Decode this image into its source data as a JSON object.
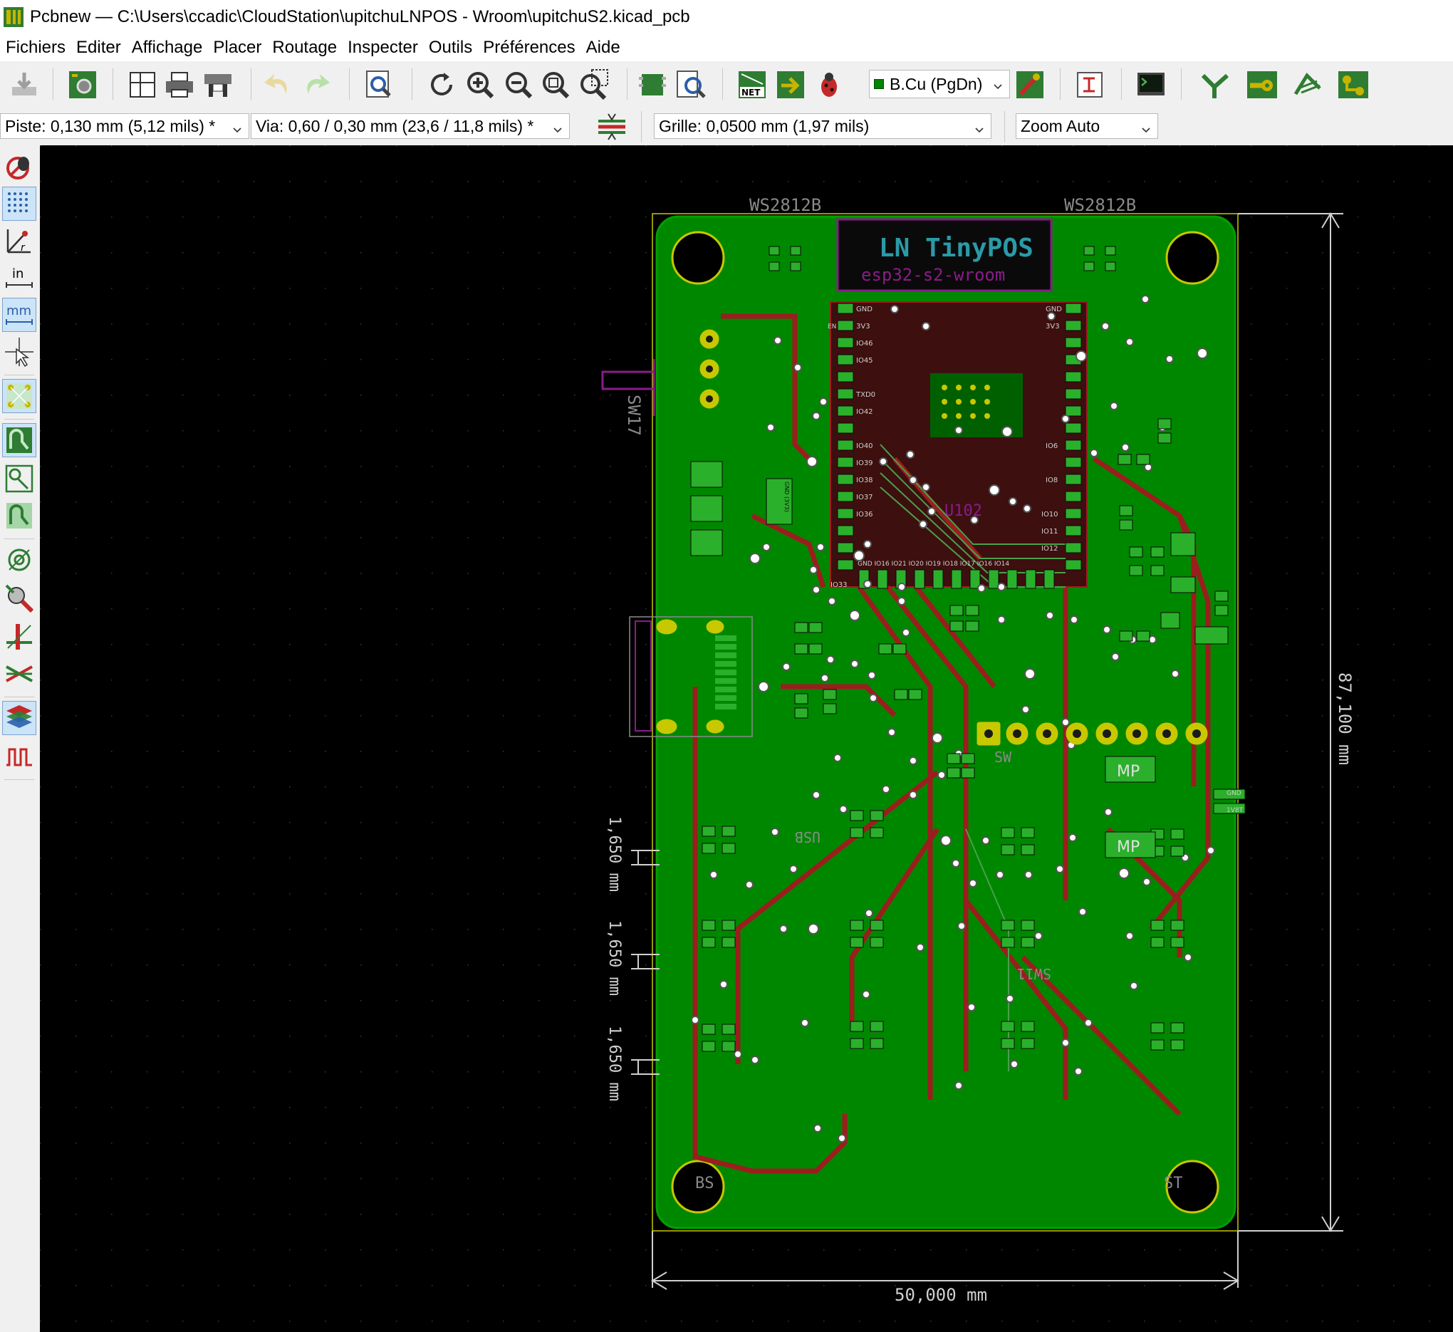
{
  "window": {
    "title": "Pcbnew — C:\\Users\\ccadic\\CloudStation\\upitchuLNPOS - Wroom\\upitchuS2.kicad_pcb"
  },
  "menubar": {
    "items": [
      "Fichiers",
      "Editer",
      "Affichage",
      "Placer",
      "Routage",
      "Inspecter",
      "Outils",
      "Préférences",
      "Aide"
    ]
  },
  "toolbar": {
    "layer_selected": "B.Cu (PgDn)",
    "track_width": "Piste: 0,130 mm (5,12 mils) *",
    "via_size": "Via: 0,60 / 0,30 mm (23,6 / 11,8 mils) *",
    "grid": "Grille: 0,0500 mm (1,97 mils)",
    "zoom": "Zoom Auto"
  },
  "board": {
    "silkscreen_title": "LN TinyPOS",
    "module_name": "esp32-s2-wroom",
    "led_label_left": "WS2812B",
    "led_label_right": "WS2812B",
    "switch_label": "SW17",
    "mp_label_1": "MP",
    "mp_label_2": "MP",
    "dim_height": "87,100 mm",
    "dim_width": "50,000 mm",
    "dim_gap_1": "1,650 mm",
    "dim_gap_2": "1,650 mm",
    "dim_gap_3": "1,650 mm",
    "corner_label_left": "BS",
    "corner_label_right": "ST",
    "pin_gnd": "GND",
    "pin_3v3": "3V3",
    "pin_en": "EN",
    "pin_io46": "IO46",
    "pin_io45": "IO45",
    "pin_txd0": "TXD0",
    "pin_io42": "IO42",
    "pin_io40": "IO40",
    "pin_io39": "IO39",
    "pin_io38": "IO38",
    "pin_io37": "IO37",
    "pin_io36": "IO36",
    "pin_io6": "IO6",
    "pin_io8": "IO8",
    "pin_io10": "IO10",
    "pin_io11": "IO11",
    "pin_io12": "IO12",
    "pin_io33": "IO33",
    "bottom_pins": "GND IO16 IO21 IO20 IO19 IO18 IO17 IO16 IO14",
    "cap_label": "GND (3V3)",
    "u102_label": "U102",
    "sw_label_mid": "SW",
    "sw_label_lower": "SW11",
    "usb_label": "USB",
    "label_1v8": "1V8T",
    "label_gnd_small": "GND"
  },
  "colors": {
    "board_green": "#008700",
    "trace_red": "#9b1e1e",
    "background": "#000000",
    "silk": "#c8c8c8",
    "pad_yellow": "#c8c800",
    "cyan_text": "#2a9aa8",
    "magenta": "#8a1c8a"
  }
}
